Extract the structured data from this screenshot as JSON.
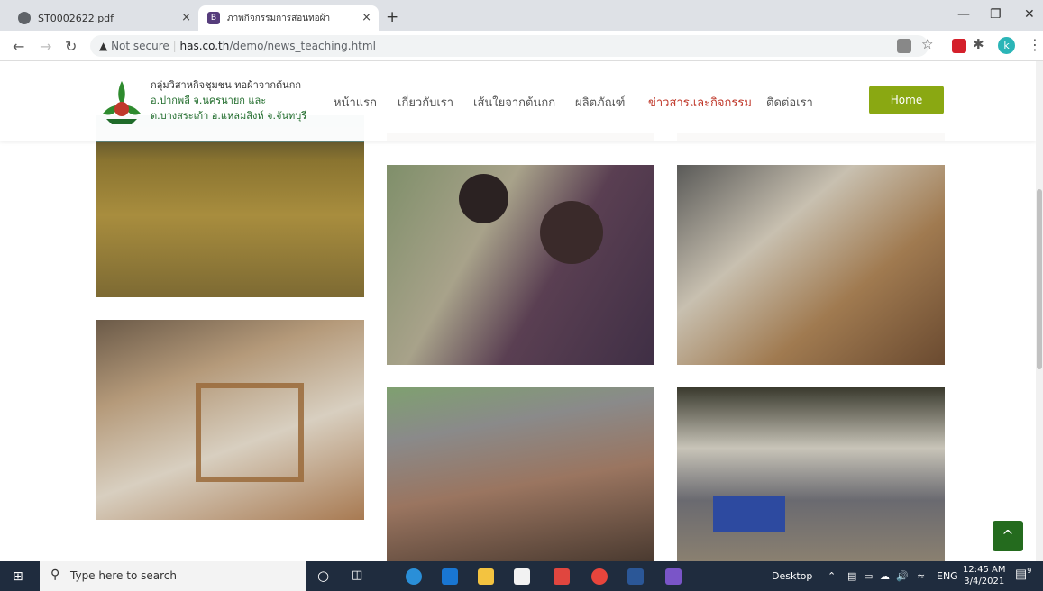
{
  "browser": {
    "tab1_title": "ST0002622.pdf",
    "tab2_title": "ภาพกิจกรรมการสอนทอผ้า",
    "new_tab": "+",
    "close": "×",
    "not_secure": "Not secure",
    "url_domain": "has.co.th",
    "url_path": "/demo/news_teaching.html",
    "profile_initial": "k"
  },
  "site": {
    "logo_line1": "กลุ่มวิสาหกิจชุมชน ทอผ้าจากต้นกก",
    "logo_line2": "อ.ปากพลี จ.นครนายก และ",
    "logo_line3": "ต.บางสระเก้า อ.แหลมสิงห์ จ.จันทบุรี",
    "menu": [
      "หน้าแรก",
      "เกี่ยวกับเรา",
      "เส้นใยจากต้นกก",
      "ผลิตภัณฑ์",
      "ข่าวสารและกิจกรรม",
      "ติดต่อเรา"
    ],
    "active_menu": "ข่าวสารและกิจกรรม",
    "home_button": "Home",
    "back_to_top": "^"
  },
  "colors": {
    "accent_green": "#8aa812",
    "active_red": "#c0392b",
    "dark_green": "#246b1e"
  },
  "taskbar": {
    "search_placeholder": "Type here to search",
    "desktop": "Desktop",
    "lang": "ENG",
    "time": "12:45 AM",
    "date": "3/4/2021",
    "notifications": "9"
  }
}
